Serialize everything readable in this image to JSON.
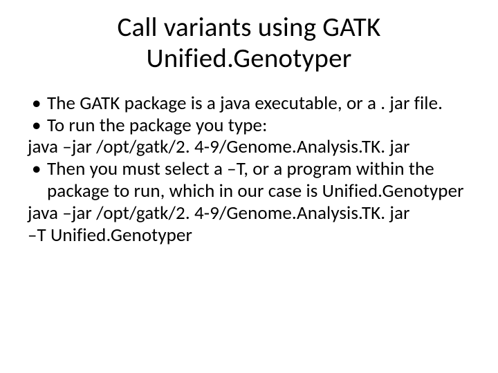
{
  "title_line1": "Call variants using GATK",
  "title_line2": "Unified.Genotyper",
  "bullets": {
    "b1": "The GATK package is a java executable, or a . jar file.",
    "b2": "To run the package you type:",
    "b3": "java –jar /opt/gatk/2. 4-9/Genome.Analysis.TK. jar",
    "b4": "Then you must select a –T, or a program within the package to run, which in our case is Unified.Genotyper",
    "b5a": "java –jar /opt/gatk/2. 4-9/Genome.Analysis.TK. jar",
    "b5b": "–T Unified.Genotyper"
  },
  "dot": "•"
}
